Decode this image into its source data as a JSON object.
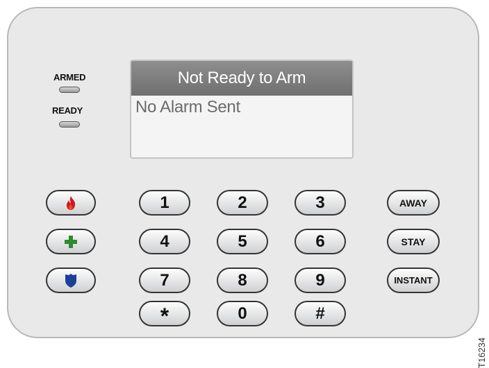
{
  "indicators": {
    "armed": "ARMED",
    "ready": "READY"
  },
  "display": {
    "header": "Not Ready to Arm",
    "line1": "No Alarm Sent"
  },
  "keys": {
    "k1": "1",
    "k2": "2",
    "k3": "3",
    "k4": "4",
    "k5": "5",
    "k6": "6",
    "k7": "7",
    "k8": "8",
    "k9": "9",
    "star": "*",
    "k0": "0",
    "hash": "#"
  },
  "function_keys": {
    "away": "AWAY",
    "stay": "STAY",
    "instant": "INSTANT"
  },
  "emergency_keys": {
    "fire": "fire-icon",
    "medical": "medical-cross-icon",
    "police": "police-shield-icon"
  },
  "colors": {
    "fire": "#d4171c",
    "medical": "#2e8b2e",
    "police": "#1d3f9a",
    "display_header": "#7a7a7a"
  },
  "figure_id": "T16234"
}
